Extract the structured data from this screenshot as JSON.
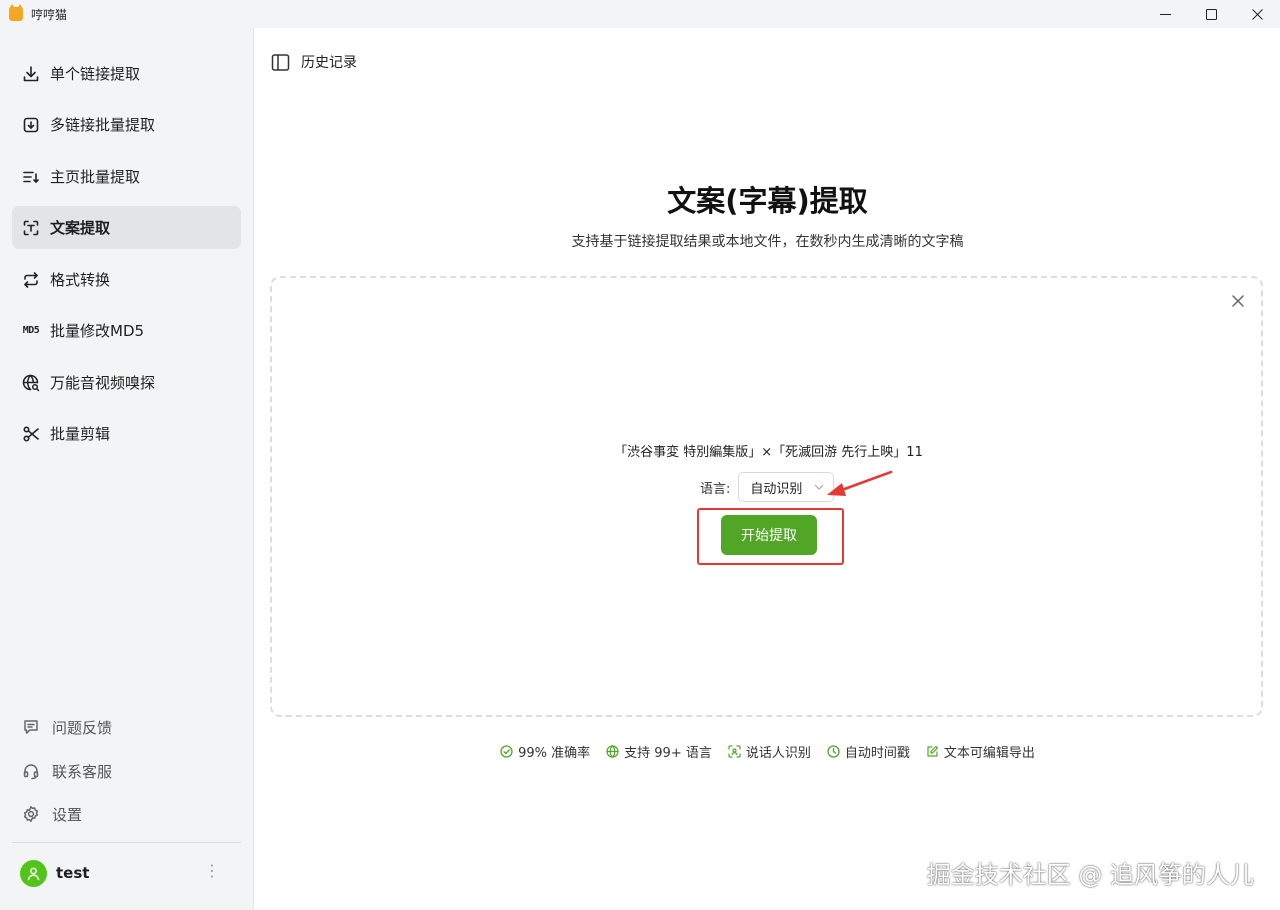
{
  "window": {
    "title": "哼哼猫"
  },
  "sidebar": {
    "items": [
      {
        "label": "单个链接提取",
        "icon": "download-icon",
        "active": false
      },
      {
        "label": "多链接批量提取",
        "icon": "tray-download-icon",
        "active": false
      },
      {
        "label": "主页批量提取",
        "icon": "list-download-icon",
        "active": false
      },
      {
        "label": "文案提取",
        "icon": "text-scan-icon",
        "active": true
      },
      {
        "label": "格式转换",
        "icon": "swap-arrows-icon",
        "active": false
      },
      {
        "label": "批量修改MD5",
        "icon": "md5-icon",
        "active": false
      },
      {
        "label": "万能音视频嗅探",
        "icon": "globe-search-icon",
        "active": false
      },
      {
        "label": "批量剪辑",
        "icon": "scissors-icon",
        "active": false
      }
    ],
    "md5_icon_text": "MD5",
    "footer": [
      {
        "label": "问题反馈",
        "icon": "feedback-icon"
      },
      {
        "label": "联系客服",
        "icon": "headset-icon"
      },
      {
        "label": "设置",
        "icon": "gear-icon"
      }
    ],
    "user": {
      "name": "test",
      "more": "⋮"
    }
  },
  "main": {
    "history_label": "历史记录",
    "title": "文案(字幕)提取",
    "subtitle": "支持基于链接提取结果或本地文件，在数秒内生成清晰的文字稿",
    "file_name": "「渋谷事変 特別編集版」×「死滅回游 先行上映」11",
    "language_label": "语言:",
    "language_value": "自动识别",
    "start_button": "开始提取",
    "features": [
      {
        "label": "99% 准确率",
        "icon": "check-circle-icon"
      },
      {
        "label": "支持 99+ 语言",
        "icon": "globe-icon"
      },
      {
        "label": "说话人识别",
        "icon": "speaker-scan-icon"
      },
      {
        "label": "自动时间戳",
        "icon": "clock-icon"
      },
      {
        "label": "文本可编辑导出",
        "icon": "edit-icon"
      }
    ]
  },
  "watermark": "掘金技术社区 @ 追风筝的人儿",
  "colors": {
    "accent": "#52a626",
    "highlight": "#e53935",
    "active_bg": "#e3e4e8"
  }
}
